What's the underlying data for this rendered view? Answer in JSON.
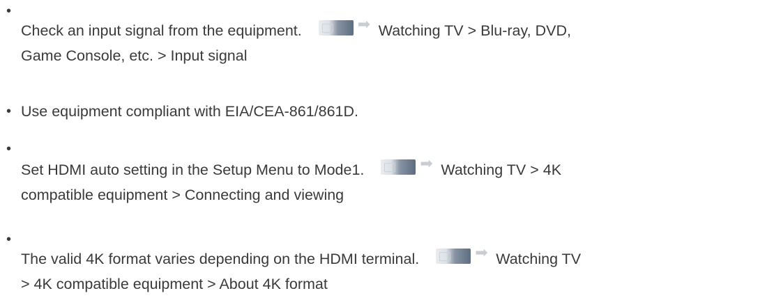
{
  "bullet_char": "•",
  "arrow_glyph": "➡",
  "items": [
    {
      "text_before_icon": "Check an input signal from the equipment.",
      "icon": "tv-screen-icon",
      "text_after_icon": "Watching TV > Blu-ray, DVD,",
      "continuation": "Game Console, etc. > Input signal"
    },
    {
      "text": "Use equipment compliant with EIA/CEA-861/861D."
    },
    {
      "text_before_icon": "Set HDMI auto setting in the Setup Menu to Mode1.",
      "icon": "tv-screen-icon",
      "text_after_icon": "Watching TV > 4K",
      "continuation": "compatible equipment > Connecting and viewing"
    },
    {
      "text_before_icon": "The valid 4K format varies depending on the HDMI terminal.",
      "icon": "tv-screen-icon",
      "text_after_icon": "Watching TV",
      "continuation": "> 4K compatible equipment > About 4K format"
    }
  ]
}
